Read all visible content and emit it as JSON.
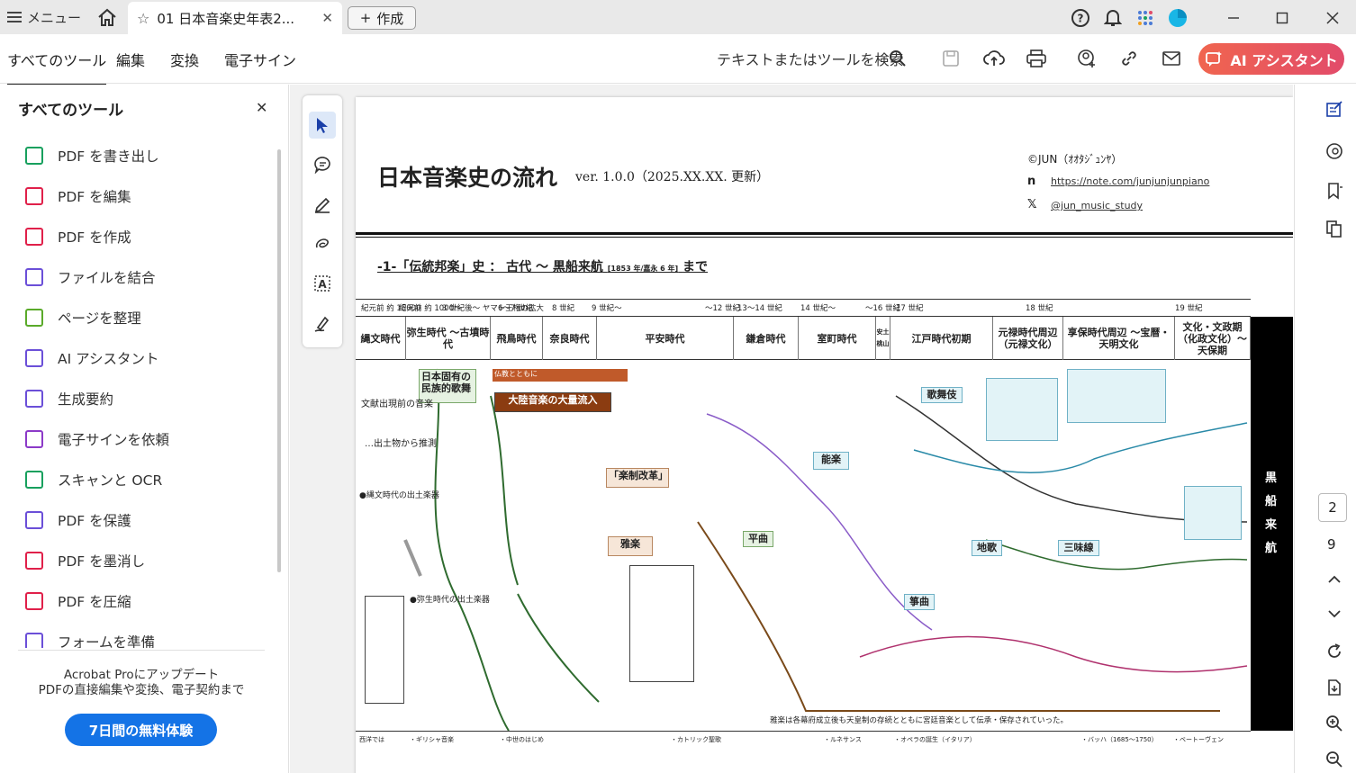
{
  "titlebar": {
    "menu_label": "メニュー",
    "tab_title": "01 日本音楽史年表2...",
    "new_label": "作成"
  },
  "toolbar": {
    "menus": [
      "すべてのツール",
      "編集",
      "変換",
      "電子サイン"
    ],
    "search_label": "テキストまたはツールを検索",
    "ai_button": "AI アシスタント"
  },
  "left_panel": {
    "title": "すべてのツール",
    "items": [
      {
        "label": "PDF を書き出し",
        "icon": "export-pdf-icon",
        "color": "#18a05e"
      },
      {
        "label": "PDF を編集",
        "icon": "edit-pdf-icon",
        "color": "#e0204a"
      },
      {
        "label": "PDF を作成",
        "icon": "create-pdf-icon",
        "color": "#e0204a"
      },
      {
        "label": "ファイルを結合",
        "icon": "combine-files-icon",
        "color": "#6b4fd8"
      },
      {
        "label": "ページを整理",
        "icon": "organize-pages-icon",
        "color": "#5aaa2a"
      },
      {
        "label": "AI アシスタント",
        "icon": "ai-assistant-icon",
        "color": "#6b4fd8"
      },
      {
        "label": "生成要約",
        "icon": "summary-icon",
        "color": "#6b4fd8"
      },
      {
        "label": "電子サインを依頼",
        "icon": "request-signature-icon",
        "color": "#8c3ac8"
      },
      {
        "label": "スキャンと OCR",
        "icon": "scan-ocr-icon",
        "color": "#18a05e"
      },
      {
        "label": "PDF を保護",
        "icon": "protect-pdf-icon",
        "color": "#6b4fd8"
      },
      {
        "label": "PDF を墨消し",
        "icon": "redact-pdf-icon",
        "color": "#e0204a"
      },
      {
        "label": "PDF を圧縮",
        "icon": "compress-pdf-icon",
        "color": "#e0204a"
      },
      {
        "label": "フォームを準備",
        "icon": "prepare-form-icon",
        "color": "#6b4fd8"
      }
    ],
    "promo_line1": "Acrobat Proにアップデート",
    "promo_line2": "PDFの直接編集や変換、電子契約まで",
    "trial_button": "7日間の無料体験"
  },
  "document": {
    "title": "日本音楽史の流れ",
    "version": "ver. 1.0.0（2025.XX.XX. 更新）",
    "credit": "©JUN（ｵｵﾀｼﾞｭﾝﾔ）",
    "note_link": "https://note.com/junjunjunpiano",
    "x_link": "@jun_music_study",
    "section_title": "-1-「伝統邦楽」史 ： 古代 〜 黒船来航",
    "section_sub": "[1853 年/嘉永 6 年]",
    "section_end": "まで",
    "eras": [
      "紀元前 約 15000",
      "紀元前 約 1000〜",
      "3 世紀後〜 ヤマト王権の拡大",
      "6〜7 世紀",
      "8 世紀",
      "9 世紀〜",
      "〜12 世紀",
      "13〜14 世紀",
      "14 世紀〜",
      "〜16 世紀",
      "17 世紀",
      "18 世紀",
      "19 世紀"
    ],
    "periods": [
      "縄文時代",
      "弥生時代 〜古墳時代",
      "飛鳥時代",
      "奈良時代",
      "平安時代",
      "鎌倉時代",
      "室町時代",
      "安土桃山",
      "江戸時代初期",
      "元禄時代周辺（元禄文化）",
      "享保時代周辺 〜宝暦・天明文化",
      "文化・文政期（化政文化）〜天保期"
    ],
    "black_band": [
      "黒",
      "船",
      "来",
      "航"
    ],
    "boxes": {
      "indigenous": "日本固有の民族的歌舞",
      "influx": "大陸音楽の大量流入",
      "reform": "「楽制改革」",
      "gagaku": "雅楽",
      "noh": "能楽",
      "kabuki": "歌舞伎",
      "shamisen": "三味線",
      "koto": "箏曲",
      "heike": "平曲",
      "jiuta": "地歌",
      "buddhism": "仏教とともに"
    },
    "labels": {
      "pre_history": "文献出現前の音楽",
      "excavated": "…出土物から推測",
      "jomon_items": "●縄文時代の出土楽器",
      "yayoi_items": "●弥生時代の出土楽器",
      "gagaku_note": "雅楽は各幕府成立後も天皇制の存続とともに宮廷音楽として伝承・保存されていった。"
    },
    "bottom": [
      "西洋では",
      "・ギリシャ音楽",
      "・中世のはじめ",
      "・カトリック聖歌",
      "・ルネサンス",
      "・オペラの誕生（イタリア）",
      "・バッハ（1685〜1750）",
      "・ベートーヴェン"
    ]
  },
  "right_rail": {
    "current_page": "2",
    "total_pages": "9"
  },
  "colors": {
    "accent": "#1473e6",
    "ai_gradient_start": "#f0654f",
    "ai_gradient_end": "#e24b6a"
  }
}
